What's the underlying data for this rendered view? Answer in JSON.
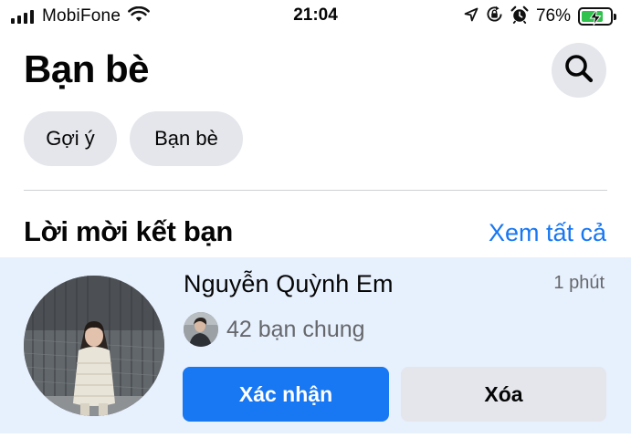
{
  "status_bar": {
    "carrier": "MobiFone",
    "time": "21:04",
    "battery_percent": "76%",
    "battery_level": 0.76,
    "icons": [
      "signal-icon",
      "wifi-icon",
      "location-icon",
      "rotation-lock-icon",
      "alarm-icon",
      "battery-charging-icon"
    ]
  },
  "header": {
    "title": "Bạn bè",
    "search_icon": "search-icon"
  },
  "chips": [
    {
      "label": "Gợi ý"
    },
    {
      "label": "Bạn bè"
    }
  ],
  "requests_section": {
    "title": "Lời mời kết bạn",
    "see_all": "Xem tất cả"
  },
  "friend_request": {
    "name": "Nguyễn Quỳnh Em",
    "time": "1 phút",
    "mutual_friends": "42 bạn chung",
    "confirm_label": "Xác nhận",
    "delete_label": "Xóa"
  },
  "colors": {
    "accent": "#1877f2",
    "card_background": "#e7f0fd",
    "chip_background": "#e4e6eb",
    "battery_green": "#31c24d"
  }
}
